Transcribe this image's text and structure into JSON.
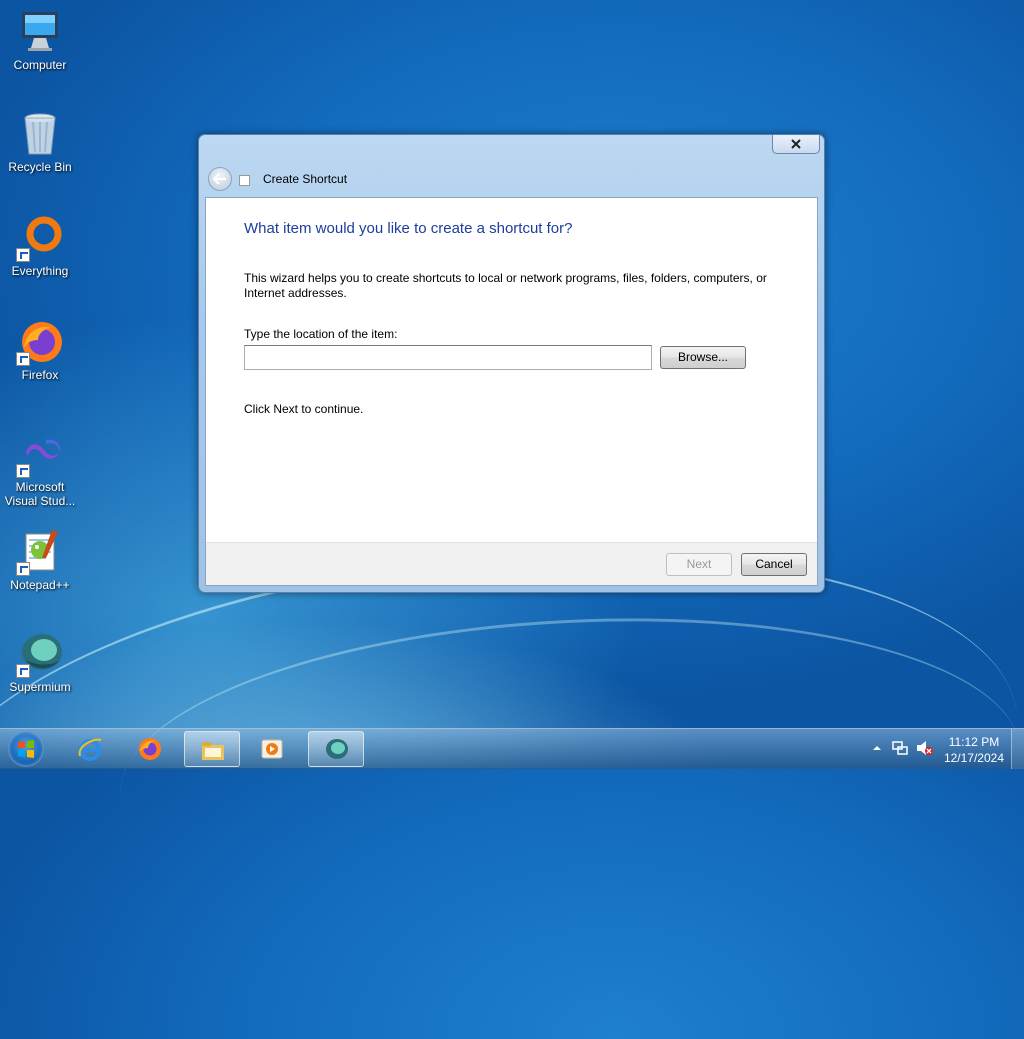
{
  "desktop": {
    "icons": [
      {
        "label": "Computer"
      },
      {
        "label": "Recycle Bin"
      },
      {
        "label": "Everything"
      },
      {
        "label": "Firefox"
      },
      {
        "label": "Microsoft Visual Stud..."
      },
      {
        "label": "Notepad++"
      },
      {
        "label": "Supermium"
      }
    ]
  },
  "dialog": {
    "title": "Create Shortcut",
    "heading": "What item would you like to create a shortcut for?",
    "description": "This wizard helps you to create shortcuts to local or network programs, files, folders, computers, or Internet addresses.",
    "location_label": "Type the location of the item:",
    "location_value": "",
    "browse_label": "Browse...",
    "continue_text": "Click Next to continue.",
    "next_label": "Next",
    "cancel_label": "Cancel"
  },
  "taskbar": {
    "pinned": [
      {
        "name": "internet-explorer-icon"
      },
      {
        "name": "firefox-icon"
      },
      {
        "name": "file-explorer-icon"
      },
      {
        "name": "media-player-icon"
      },
      {
        "name": "supermium-icon"
      }
    ],
    "clock_time": "11:12 PM",
    "clock_date": "12/17/2024"
  }
}
